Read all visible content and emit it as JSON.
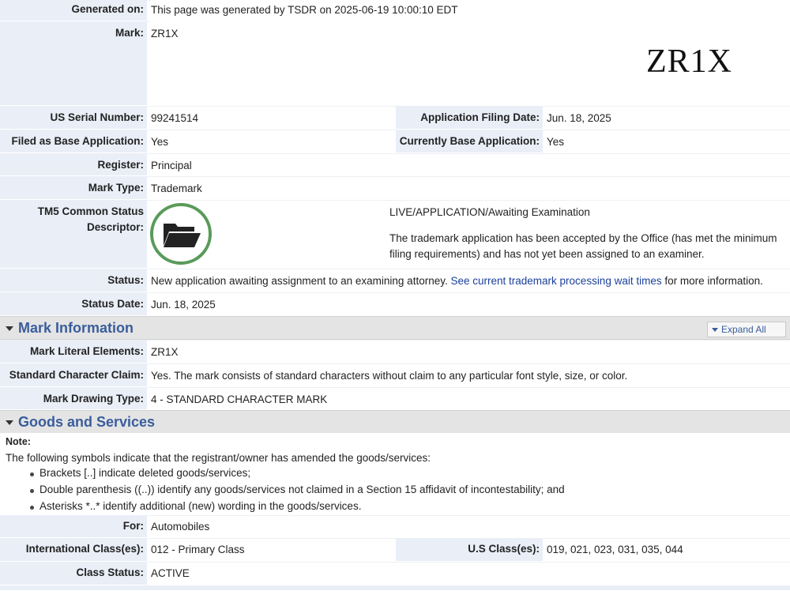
{
  "generated": {
    "label": "Generated on:",
    "value": "This page was generated by TSDR on 2025-06-19 10:00:10 EDT"
  },
  "mark": {
    "label": "Mark:",
    "value": "ZR1X",
    "image_text": "ZR1X"
  },
  "serial": {
    "label": "US Serial Number:",
    "value": "99241514"
  },
  "filing_date": {
    "label": "Application Filing Date:",
    "value": "Jun. 18, 2025"
  },
  "base_app": {
    "label": "Filed as Base Application:",
    "value": "Yes"
  },
  "current_base": {
    "label": "Currently Base Application:",
    "value": "Yes"
  },
  "register": {
    "label": "Register:",
    "value": "Principal"
  },
  "mark_type": {
    "label": "Mark Type:",
    "value": "Trademark"
  },
  "tm5": {
    "label_line1": "TM5 Common Status",
    "label_line2": "Descriptor:",
    "status_title": "LIVE/APPLICATION/Awaiting Examination",
    "desc_line1": "The trademark application has been accepted by the Office (has met the minimum",
    "desc_line2": "filing requirements) and has not yet been assigned to an examiner.",
    "icon": "folder-icon",
    "icon_ring_color": "#5a9a5a"
  },
  "status": {
    "label": "Status:",
    "text_before": "New application awaiting assignment to an examining attorney.",
    "link_text": "See current trademark processing wait times",
    "text_after": "for more information."
  },
  "status_date": {
    "label": "Status Date:",
    "value": "Jun. 18, 2025"
  },
  "mark_info": {
    "title": "Mark Information",
    "expand_label": "Expand All",
    "literal": {
      "label": "Mark Literal Elements:",
      "value": "ZR1X"
    },
    "std_char": {
      "label": "Standard Character Claim:",
      "value": "Yes. The mark consists of standard characters without claim to any particular font style, size, or color."
    },
    "drawing": {
      "label": "Mark Drawing Type:",
      "value": "4 - STANDARD CHARACTER MARK"
    }
  },
  "goods": {
    "title": "Goods and Services",
    "note_label": "Note:",
    "note_text": "The following symbols indicate that the registrant/owner has amended the goods/services:",
    "bullets": [
      "Brackets [..] indicate deleted goods/services;",
      "Double parenthesis ((..)) identify any goods/services not claimed in a Section 15 affidavit of incontestability; and",
      "Asterisks *..* identify additional (new) wording in the goods/services."
    ],
    "for": {
      "label": "For:",
      "value": "Automobiles"
    },
    "intl_class": {
      "label": "International Class(es):",
      "value": "012 - Primary Class"
    },
    "us_class": {
      "label": "U.S Class(es):",
      "value": "019, 021, 023, 031, 035, 044"
    },
    "class_status": {
      "label": "Class Status:",
      "value": "ACTIVE"
    }
  },
  "colors": {
    "label_bg": "#e9eef7",
    "section_bg": "#e4e4e4",
    "section_title": "#3a5d9c",
    "link": "#1a3f9c"
  }
}
